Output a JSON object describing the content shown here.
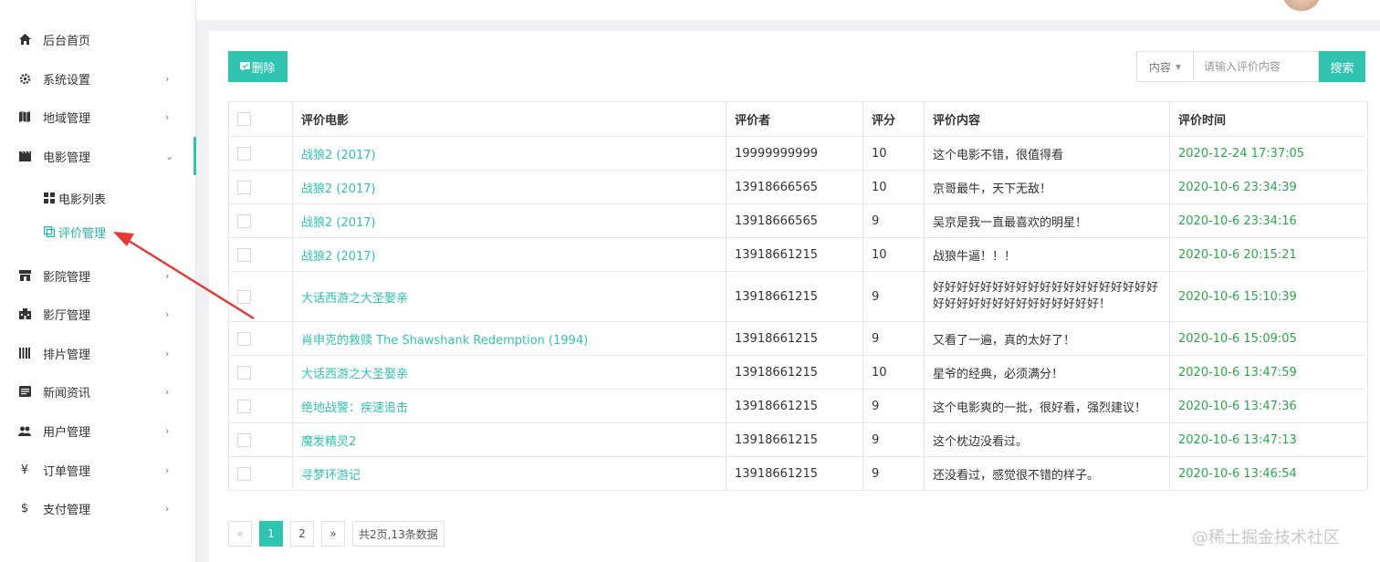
{
  "sidebar": {
    "items": [
      {
        "label": "后台首页",
        "icon": "home-icon",
        "arrow": ""
      },
      {
        "label": "系统设置",
        "icon": "gear-icon",
        "arrow": "›"
      },
      {
        "label": "地域管理",
        "icon": "map-icon",
        "arrow": "›"
      },
      {
        "label": "电影管理",
        "icon": "film-icon",
        "arrow": "⌄"
      },
      {
        "label": "影院管理",
        "icon": "store-icon",
        "arrow": "›"
      },
      {
        "label": "影厅管理",
        "icon": "building-icon",
        "arrow": "›"
      },
      {
        "label": "排片管理",
        "icon": "schedule-icon",
        "arrow": "›"
      },
      {
        "label": "新闻资讯",
        "icon": "news-icon",
        "arrow": "›"
      },
      {
        "label": "用户管理",
        "icon": "users-icon",
        "arrow": "›"
      },
      {
        "label": "订单管理",
        "icon": "yen-icon",
        "arrow": "›"
      },
      {
        "label": "支付管理",
        "icon": "dollar-icon",
        "arrow": "›"
      }
    ],
    "sub_items": [
      {
        "label": "电影列表",
        "icon": "grid-icon"
      },
      {
        "label": "评价管理",
        "icon": "comment-icon"
      }
    ]
  },
  "toolbar": {
    "delete_label": "删除",
    "search_field_select": "内容",
    "search_placeholder": "请输入评价内容",
    "search_label": "搜索"
  },
  "table": {
    "headers": [
      "评价电影",
      "评价者",
      "评分",
      "评价内容",
      "评价时间"
    ],
    "rows": [
      {
        "movie": "战狼2 (2017)",
        "reviewer": "19999999999",
        "score": "10",
        "content": "这个电影不错，很值得看",
        "time": "2020-12-24 17:37:05"
      },
      {
        "movie": "战狼2 (2017)",
        "reviewer": "13918666565",
        "score": "10",
        "content": "京哥最牛，天下无敌！",
        "time": "2020-10-6 23:34:39"
      },
      {
        "movie": "战狼2 (2017)",
        "reviewer": "13918666565",
        "score": "9",
        "content": "吴京是我一直最喜欢的明星！",
        "time": "2020-10-6 23:34:16"
      },
      {
        "movie": "战狼2 (2017)",
        "reviewer": "13918661215",
        "score": "10",
        "content": "战狼牛逼！！！",
        "time": "2020-10-6 20:15:21"
      },
      {
        "movie": "大话西游之大圣娶亲",
        "reviewer": "13918661215",
        "score": "9",
        "content": "好好好好好好好好好好好好好好好好好好好好好好好好好好好好好好好好好！",
        "time": "2020-10-6 15:10:39"
      },
      {
        "movie": "肖申克的救赎 The Shawshank Redemption (1994)",
        "reviewer": "13918661215",
        "score": "9",
        "content": "又看了一遍，真的太好了！",
        "time": "2020-10-6 15:09:05"
      },
      {
        "movie": "大话西游之大圣娶亲",
        "reviewer": "13918661215",
        "score": "10",
        "content": "星爷的经典，必须满分！",
        "time": "2020-10-6 13:47:59"
      },
      {
        "movie": "绝地战警：疾速追击",
        "reviewer": "13918661215",
        "score": "9",
        "content": "这个电影爽的一批，很好看，强烈建议！",
        "time": "2020-10-6 13:47:36"
      },
      {
        "movie": "魔发精灵2",
        "reviewer": "13918661215",
        "score": "9",
        "content": "这个枕边没看过。",
        "time": "2020-10-6 13:47:13"
      },
      {
        "movie": "寻梦环游记",
        "reviewer": "13918661215",
        "score": "9",
        "content": "还没看过，感觉很不错的样子。",
        "time": "2020-10-6 13:46:54"
      }
    ]
  },
  "pagination": {
    "prev": "«",
    "pages": [
      "1",
      "2"
    ],
    "next": "»",
    "summary": "共2页,13条数据"
  },
  "watermark": "@稀土掘金技术社区",
  "colors": {
    "accent": "#2ec4b0",
    "time": "#2aa84a",
    "annotation_arrow": "#e53935"
  }
}
